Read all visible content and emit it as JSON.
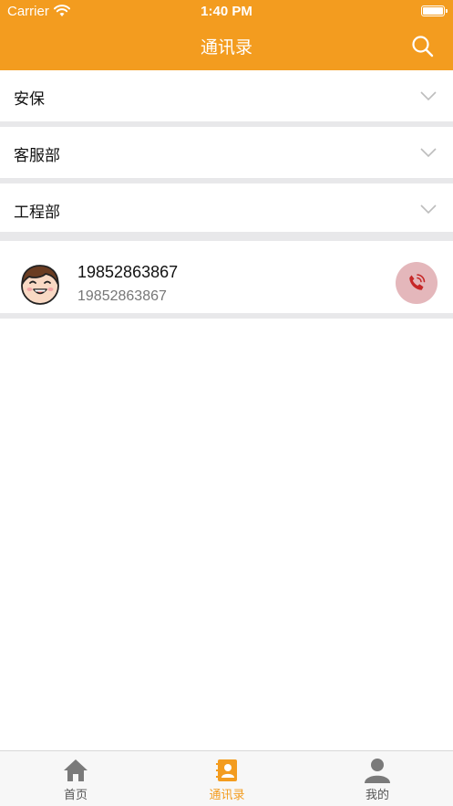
{
  "status_bar": {
    "carrier": "Carrier",
    "time": "1:40 PM"
  },
  "header": {
    "title": "通讯录"
  },
  "groups": [
    {
      "label": "安保"
    },
    {
      "label": "客服部"
    },
    {
      "label": "工程部"
    }
  ],
  "contacts": [
    {
      "name": "19852863867",
      "phone": "19852863867"
    }
  ],
  "tabs": [
    {
      "label": "首页"
    },
    {
      "label": "通讯录"
    },
    {
      "label": "我的"
    }
  ],
  "colors": {
    "accent": "#f39c1f",
    "call_bg": "#e4b7bb",
    "call_icon": "#c62828"
  },
  "icons": [
    "wifi-icon",
    "battery-icon",
    "search-icon",
    "chevron-down-icon",
    "avatar",
    "phone-icon",
    "home-icon",
    "contacts-icon",
    "user-icon"
  ]
}
